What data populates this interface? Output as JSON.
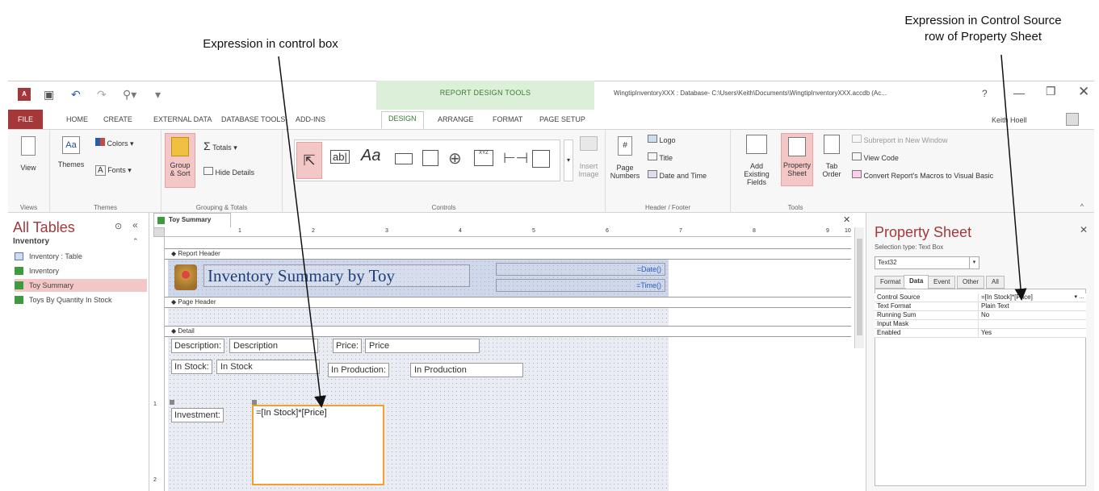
{
  "callouts": {
    "left": "Expression in control box",
    "right_line1": "Expression in Control Source",
    "right_line2": "row of Property Sheet"
  },
  "titlebar": {
    "context_group": "REPORT DESIGN TOOLS",
    "title": "WingtipInventoryXXX : Database- C:\\Users\\Keith\\Documents\\WingtipInventoryXXX.accdb (Ac...",
    "help": "?",
    "user": "Keith Hoell"
  },
  "tabs": [
    "FILE",
    "HOME",
    "CREATE",
    "EXTERNAL DATA",
    "DATABASE TOOLS",
    "ADD-INS",
    "DESIGN",
    "ARRANGE",
    "FORMAT",
    "PAGE SETUP"
  ],
  "ribbon": {
    "views": {
      "view": "View",
      "label": "Views"
    },
    "themes": {
      "themes": "Themes",
      "colors": "Colors",
      "fonts": "Fonts",
      "label": "Themes"
    },
    "grouping": {
      "group_sort_1": "Group",
      "group_sort_2": "& Sort",
      "totals": "Totals",
      "hide_details": "Hide Details",
      "label": "Grouping & Totals"
    },
    "controls": {
      "insert_image_1": "Insert",
      "insert_image_2": "Image",
      "label": "Controls",
      "aa": "Aa",
      "ab": "ab|"
    },
    "header_footer": {
      "page_numbers_1": "Page",
      "page_numbers_2": "Numbers",
      "logo": "Logo",
      "title": "Title",
      "date_time": "Date and Time",
      "label": "Header / Footer"
    },
    "tools": {
      "add_existing_1": "Add Existing",
      "add_existing_2": "Fields",
      "property_sheet_1": "Property",
      "property_sheet_2": "Sheet",
      "tab_order_1": "Tab",
      "tab_order_2": "Order",
      "subreport": "Subreport in New Window",
      "view_code": "View Code",
      "convert_macros": "Convert Report's Macros to Visual Basic",
      "label": "Tools"
    }
  },
  "nav": {
    "title": "All Tables",
    "group": "Inventory",
    "items": [
      "Inventory : Table",
      "Inventory",
      "Toy Summary",
      "Toys By Quantity In Stock"
    ]
  },
  "document": {
    "tab": "Toy Summary",
    "sections": {
      "report_header": "Report Header",
      "page_header": "Page Header",
      "detail": "Detail"
    },
    "report_title": "Inventory Summary by Toy",
    "date_expr": "=Date()",
    "time_expr": "=Time()",
    "fields": {
      "description_label": "Description:",
      "description_value": "Description",
      "price_label": "Price:",
      "price_value": "Price",
      "instock_label": "In Stock:",
      "instock_value": "In Stock",
      "inproduction_label": "In Production:",
      "inproduction_value": "In Production",
      "investment_label": "Investment:",
      "investment_expr": "=[In Stock]*[Price]"
    },
    "ruler_numbers": [
      "1",
      "2",
      "3",
      "4",
      "5",
      "6",
      "7",
      "8",
      "9",
      "10"
    ],
    "vruler_numbers": [
      "1",
      "2"
    ]
  },
  "property_sheet": {
    "title": "Property Sheet",
    "selection_type": "Selection type:  Text Box",
    "selected_control": "Text32",
    "tabs": [
      "Format",
      "Data",
      "Event",
      "Other",
      "All"
    ],
    "active_tab": "Data",
    "rows": [
      {
        "name": "Control Source",
        "value": "=[In Stock]*[Price]"
      },
      {
        "name": "Text Format",
        "value": "Plain Text"
      },
      {
        "name": "Running Sum",
        "value": "No"
      },
      {
        "name": "Input Mask",
        "value": ""
      },
      {
        "name": "Enabled",
        "value": "Yes"
      }
    ]
  },
  "colors": {
    "file_tab": "#a4373a",
    "accent_green": "#2e7a2e",
    "selection_orange": "#f0a030",
    "nav_selected": "#f4c7c7"
  }
}
